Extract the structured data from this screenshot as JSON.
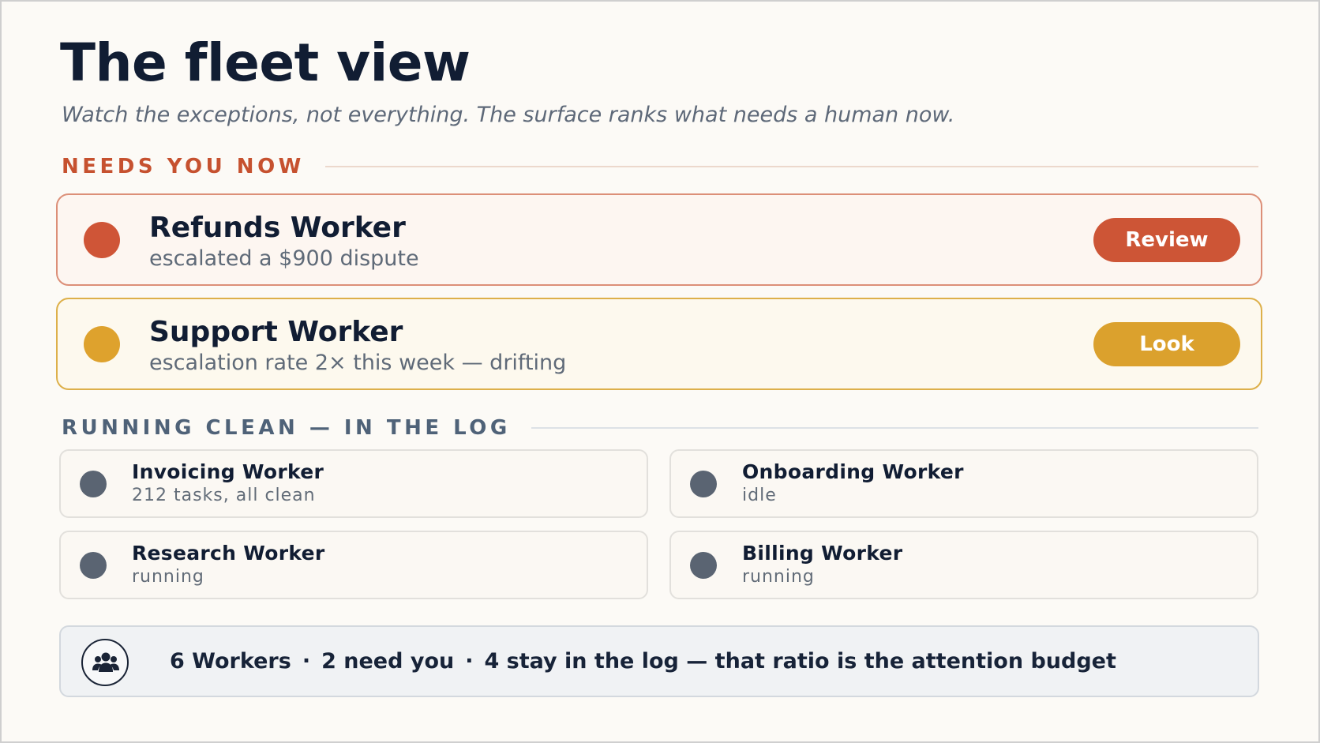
{
  "header": {
    "title": "The fleet view",
    "subtitle": "Watch the exceptions, not everything. The surface ranks what needs a human now."
  },
  "needs_section": {
    "label": "NEEDS YOU NOW",
    "items": [
      {
        "name": "Refunds Worker",
        "description": "escalated a $900 dispute",
        "action": "Review",
        "severity_color": "#cf5537"
      },
      {
        "name": "Support Worker",
        "description": "escalation rate 2× this week — drifting",
        "action": "Look",
        "severity_color": "#dea22d"
      }
    ]
  },
  "clean_section": {
    "label": "RUNNING CLEAN — IN THE LOG",
    "items": [
      {
        "name": "Invoicing Worker",
        "status": "212 tasks, all clean"
      },
      {
        "name": "Onboarding Worker",
        "status": "idle"
      },
      {
        "name": "Research Worker",
        "status": "running"
      },
      {
        "name": "Billing Worker",
        "status": "running"
      }
    ]
  },
  "summary": {
    "icon": "people-icon",
    "total": "6 Workers",
    "need": "2 need you",
    "rest": "4 stay in the log — that ratio is the attention budget",
    "separator": "·"
  }
}
